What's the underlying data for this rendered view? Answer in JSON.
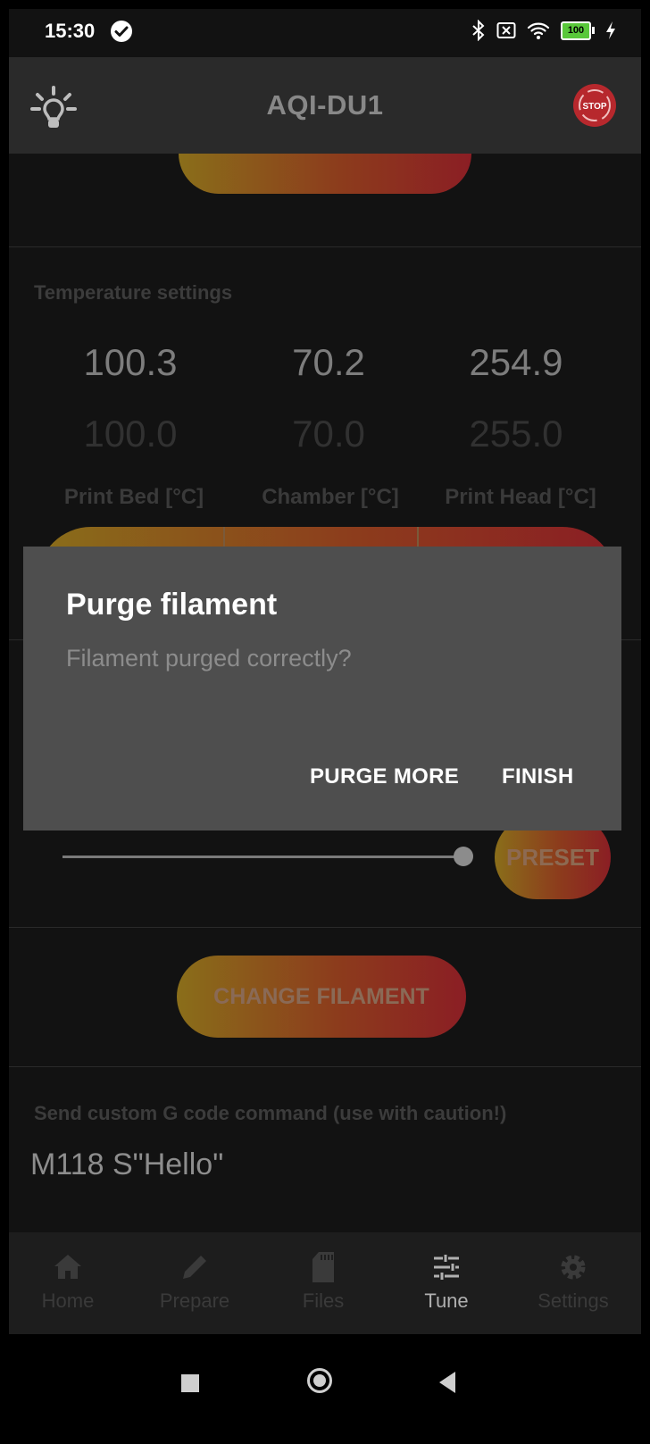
{
  "status_bar": {
    "time": "15:30",
    "battery": "100"
  },
  "app_bar": {
    "title": "AQI-DU1",
    "light_icon": "lightbulb-icon",
    "stop_label": "STOP"
  },
  "temperature": {
    "section_title": "Temperature settings",
    "columns": [
      {
        "current": "100.3",
        "target": "100.0",
        "label": "Print Bed [°C]"
      },
      {
        "current": "70.2",
        "target": "70.0",
        "label": "Chamber [°C]"
      },
      {
        "current": "254.9",
        "target": "255.0",
        "label": "Print Head [°C]"
      }
    ]
  },
  "slider": {
    "level": 1.0
  },
  "preset_button": "PRESET",
  "change_filament_button": "CHANGE FILAMENT",
  "gcode": {
    "section_title": "Send custom G code command (use with caution!)",
    "value": "M118 S\"Hello\""
  },
  "dialog": {
    "title": "Purge filament",
    "message": "Filament purged correctly?",
    "purge_more": "PURGE MORE",
    "finish": "FINISH"
  },
  "bottom_nav": [
    {
      "label": "Home",
      "icon": "home-icon",
      "active": false
    },
    {
      "label": "Prepare",
      "icon": "pencil-icon",
      "active": false
    },
    {
      "label": "Files",
      "icon": "sd-card-icon",
      "active": false
    },
    {
      "label": "Tune",
      "icon": "sliders-icon",
      "active": true
    },
    {
      "label": "Settings",
      "icon": "gear-icon",
      "active": false
    }
  ],
  "colors": {
    "gradient_start": "#8a6e1a",
    "gradient_end": "#8b1e24",
    "dialog_bg": "#4e4e4e",
    "stop_red": "#b7282d"
  }
}
